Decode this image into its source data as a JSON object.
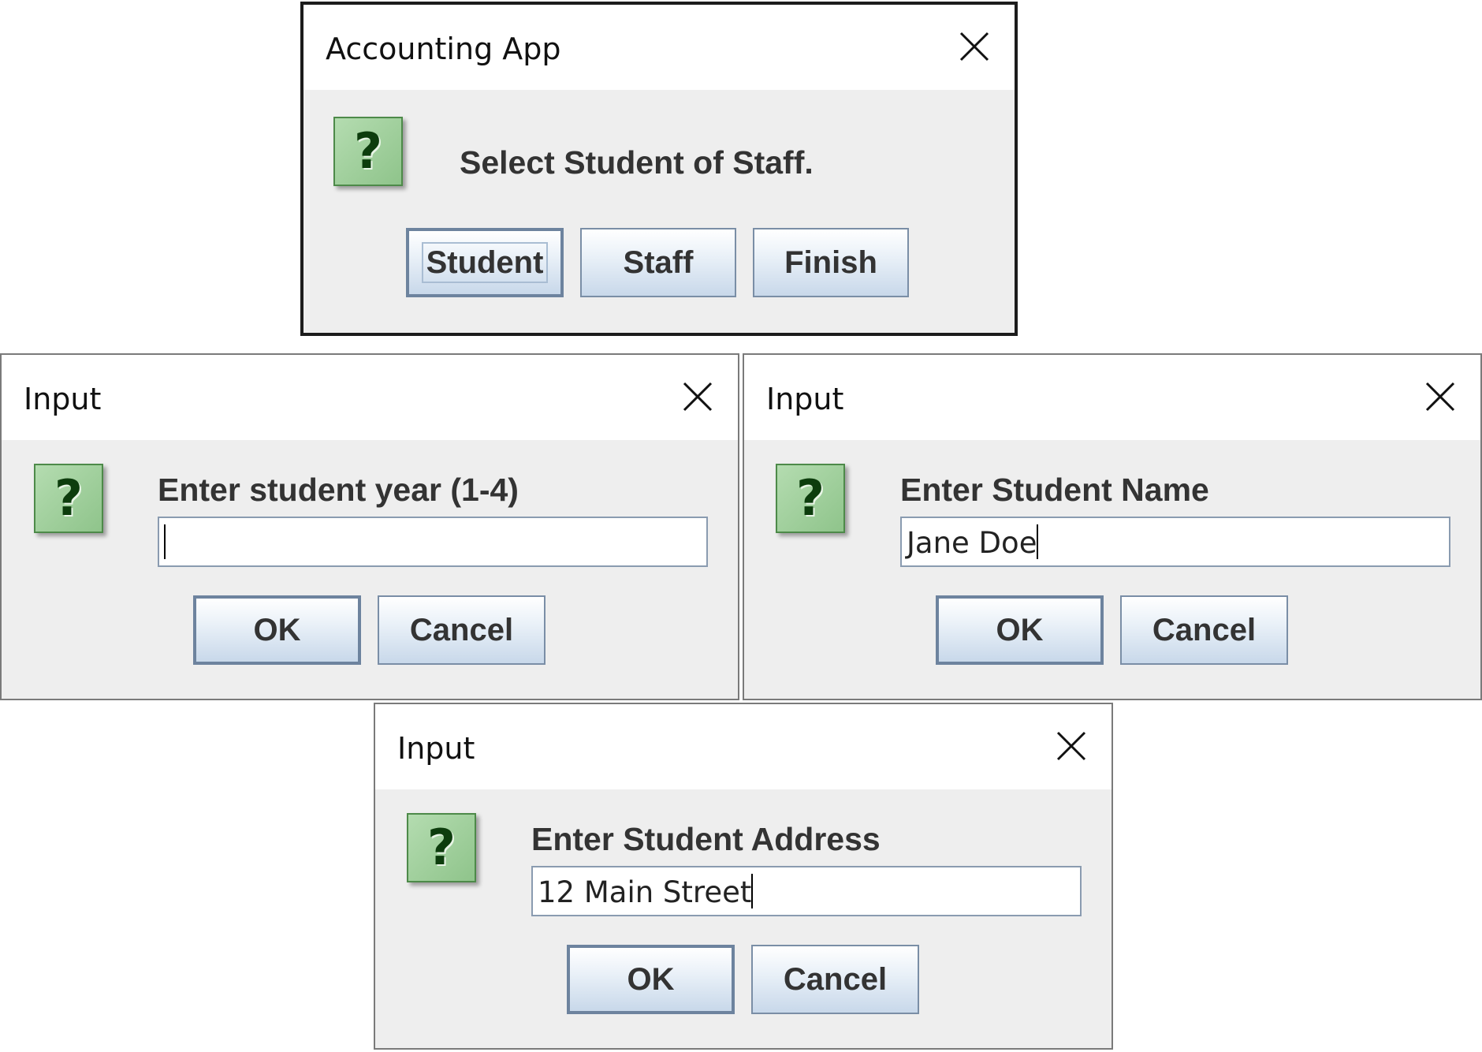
{
  "dialogs": {
    "main": {
      "title": "Accounting App",
      "message": "Select Student of Staff.",
      "icon": "question-icon",
      "buttons": [
        "Student",
        "Staff",
        "Finish"
      ]
    },
    "year": {
      "title": "Input",
      "message": "Enter student year (1-4)",
      "icon": "question-icon",
      "value": "",
      "ok": "OK",
      "cancel": "Cancel"
    },
    "name": {
      "title": "Input",
      "message": "Enter Student Name",
      "icon": "question-icon",
      "value": "Jane Doe",
      "ok": "OK",
      "cancel": "Cancel"
    },
    "address": {
      "title": "Input",
      "message": "Enter Student Address",
      "icon": "question-icon",
      "value": "12 Main Street",
      "ok": "OK",
      "cancel": "Cancel"
    }
  },
  "icons": {
    "close": "close-icon",
    "question": "?"
  },
  "colors": {
    "dialog_bg": "#eeeeee",
    "icon_green": "#8fc48b",
    "button_gradient_bottom": "#c8d8ea"
  }
}
